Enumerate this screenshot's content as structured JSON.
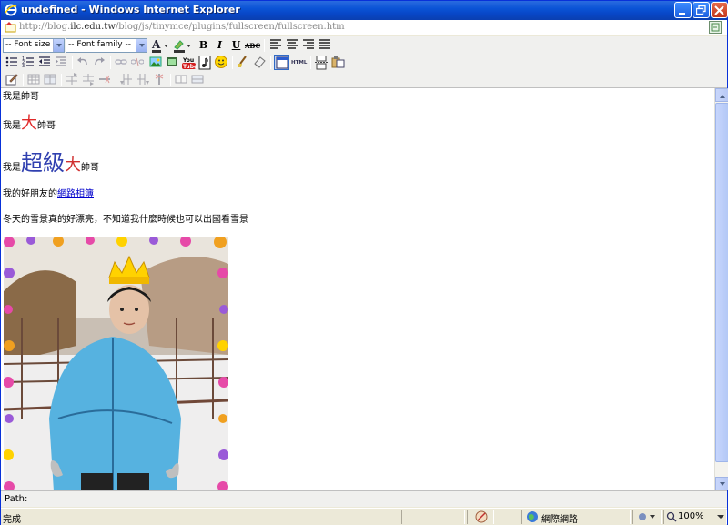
{
  "window": {
    "title": "undefined - Windows Internet Explorer"
  },
  "address": {
    "url_prefix": "http://blog.",
    "url_host": "ilc.edu.tw",
    "url_rest": "/blog/js/tinymce/plugins/fullscreen/fullscreen.htm"
  },
  "toolbar": {
    "font_size_select": "-- Font size --",
    "font_family_select": "-- Font family --",
    "bold_label": "B",
    "italic_label": "I",
    "underline_label": "U",
    "strike_label": "ABC",
    "html_label": "HTML",
    "icons": {
      "row1": [
        "font-color-icon",
        "highlight-color-icon",
        "bold-icon",
        "italic-icon",
        "underline-icon",
        "strikethrough-icon",
        "align-left-icon",
        "align-center-icon",
        "align-right-icon",
        "align-justify-icon"
      ],
      "row2": [
        "bullet-list-icon",
        "numbered-list-icon",
        "outdent-icon",
        "indent-icon",
        "undo-icon",
        "redo-icon",
        "link-icon",
        "unlink-icon",
        "image-icon",
        "media-icon",
        "youtube-icon",
        "music-icon",
        "emoticon-icon",
        "cleanup-icon",
        "eraser-icon",
        "fullscreen-icon",
        "html-source-icon",
        "page-break-icon",
        "paste-icon"
      ],
      "row3": [
        "edit-icon",
        "table-icon",
        "table-props-icon",
        "row-before-icon",
        "row-after-icon",
        "delete-row-icon",
        "col-before-icon",
        "col-after-icon",
        "delete-col-icon",
        "split-cells-icon",
        "merge-cells-icon"
      ]
    }
  },
  "editor": {
    "line1": "我是帥哥",
    "line2_a": "我是",
    "line2_b": "大",
    "line2_c": "帥哥",
    "line3_a": "我是",
    "line3_b": "超級",
    "line3_c": "大",
    "line3_d": "帥哥",
    "line4_a": "我的好朋友的",
    "line4_link": "網路相簿",
    "line5": "冬天的雪景真的好漂亮，不知道我什麼時候也可以出國看雪景"
  },
  "pathbar": {
    "label": "Path:"
  },
  "statusbar": {
    "status": "完成",
    "zone": "網際網路",
    "zoom": "100%"
  },
  "colors": {
    "titlebar": "#0a53d6",
    "link": "#0000cc",
    "red_text": "#e02a2a",
    "blue_text": "#3040b0"
  }
}
